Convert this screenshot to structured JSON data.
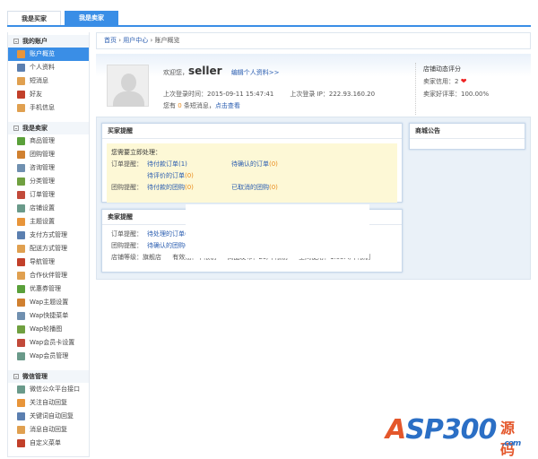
{
  "tabs": [
    "我是买家",
    "我是卖家"
  ],
  "sidebar": {
    "groups": [
      {
        "title": "我的账户",
        "items": [
          "账户概览",
          "个人资料",
          "短消息",
          "好友",
          "手机信息"
        ]
      },
      {
        "title": "我是卖家",
        "items": [
          "商品管理",
          "团购管理",
          "咨询管理",
          "分类管理",
          "订单管理",
          "店铺设置",
          "主题设置",
          "支付方式管理",
          "配送方式管理",
          "导航管理",
          "合作伙伴管理",
          "优惠券管理",
          "Wap主题设置",
          "Wap快捷菜单",
          "Wap轮播图",
          "Wap会员卡设置",
          "Wap会员管理"
        ]
      },
      {
        "title": "微信管理",
        "items": [
          "微信公众平台接口",
          "关注自动回复",
          "关键词自动回复",
          "消息自动回复",
          "自定义菜单"
        ]
      }
    ]
  },
  "breadcrumb": [
    "首页",
    "用户中心",
    "账户概览"
  ],
  "profile": {
    "welcome": "欢迎您，",
    "username": "seller",
    "edit_link": "编辑个人资料>>",
    "last_login_time": "上次登录时间：2015-09-11 15:47:41",
    "last_login_ip": "上次登录 IP：222.93.160.20",
    "msg_prefix": "您有",
    "msg_count": "0",
    "msg_suffix": "条短消息，",
    "msg_link": "点击查看"
  },
  "rating": {
    "title": "店铺动态评分",
    "credit": "卖家信用：2",
    "good_rate": "卖家好评率：100.00%"
  },
  "buyer": {
    "title": "买家提醒",
    "urgent": "您需要立即处理：",
    "order_label": "订单提醒：",
    "order_links": [
      "待付款订单",
      "待确认的订单",
      "待评价的订单"
    ],
    "order_counts": [
      "(1)",
      "(0)",
      "(0)"
    ],
    "group_label": "团购提醒：",
    "group_links": [
      "待付款的团购",
      "已取消的团购"
    ],
    "group_counts": [
      "(0)",
      "(0)"
    ]
  },
  "seller": {
    "title": "卖家提醒",
    "order_label": "订单提醒：",
    "order_link": "待处理的订单(",
    "group_label": "团购提醒：",
    "group_link": "待确认的团购(",
    "stats": [
      "店铺等级：旗舰店",
      "有效期：不限制",
      "商品发布：29/不限制",
      "空间使用：1.05M/不限制"
    ]
  },
  "notice": {
    "title": "商城公告"
  },
  "watermark": {
    "brand": "ASP300",
    "cn": "源码",
    "domain": ".com"
  }
}
